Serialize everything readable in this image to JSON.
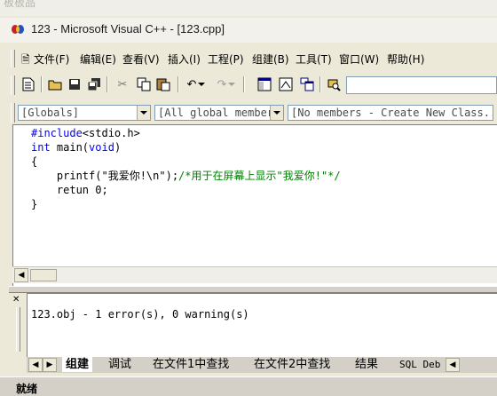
{
  "top_strip": {
    "text": "板板品"
  },
  "window": {
    "title": "123 - Microsoft Visual C++ - [123.cpp]"
  },
  "menu": {
    "items": [
      "文件(F)",
      "编辑(E)",
      "查看(V)",
      "插入(I)",
      "工程(P)",
      "组建(B)",
      "工具(T)",
      "窗口(W)",
      "帮助(H)"
    ]
  },
  "toolbar": {
    "icons": [
      "new-text-file-icon",
      "open-folder-icon",
      "save-icon",
      "save-all-icon",
      "cut-icon",
      "copy-icon",
      "paste-icon",
      "undo-icon",
      "redo-icon",
      "workspace-icon",
      "output-window-icon",
      "window-list-icon",
      "find-in-files-icon"
    ],
    "find_value": ""
  },
  "wizardbar": {
    "scope": "[Globals]",
    "filter": "[All global members",
    "members": "[No members - Create New Class...]"
  },
  "editor": {
    "lines": [
      {
        "parts": [
          {
            "t": "#include",
            "c": "kw"
          },
          {
            "t": "<stdio.h>",
            "c": ""
          }
        ]
      },
      {
        "parts": [
          {
            "t": "int",
            "c": "kw"
          },
          {
            "t": " main(",
            "c": ""
          },
          {
            "t": "void",
            "c": "kw"
          },
          {
            "t": ")",
            "c": ""
          }
        ]
      },
      {
        "parts": [
          {
            "t": "{",
            "c": ""
          }
        ]
      },
      {
        "parts": [
          {
            "t": "    printf(\"我爱你!\\n\");",
            "c": ""
          },
          {
            "t": "/*用于在屏幕上显示\"我爱你!\"*/",
            "c": "cmt"
          }
        ]
      },
      {
        "parts": [
          {
            "t": "    retun 0;",
            "c": ""
          }
        ]
      },
      {
        "parts": [
          {
            "t": "}",
            "c": ""
          }
        ]
      }
    ]
  },
  "output": {
    "message": "123.obj - 1 error(s), 0 warning(s)",
    "tabs": [
      "组建",
      "调试",
      "在文件1中查找",
      "在文件2中查找",
      "结果",
      "SQL Deb"
    ],
    "active_tab": "组建"
  },
  "status": {
    "text": "就绪"
  }
}
